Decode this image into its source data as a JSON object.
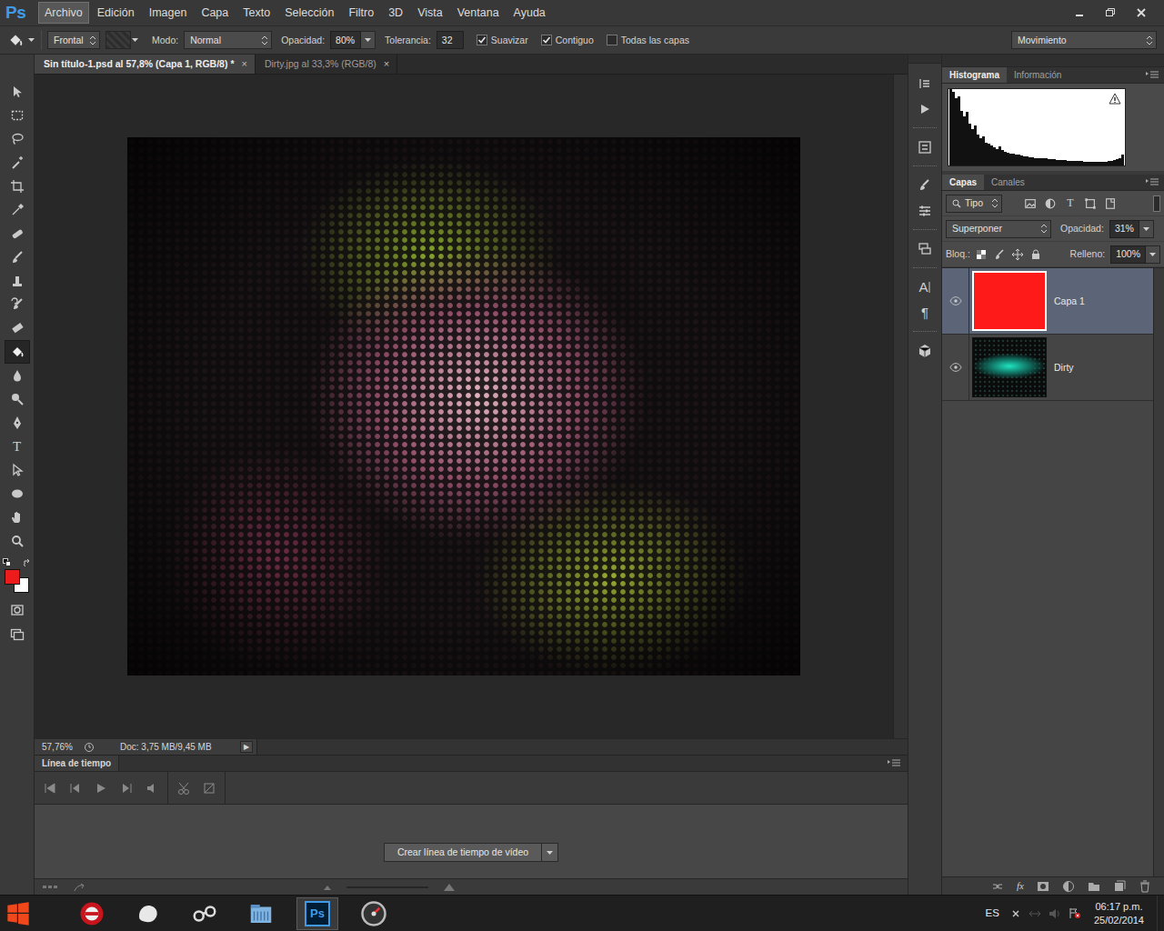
{
  "app": {
    "logo": "Ps"
  },
  "menu": [
    {
      "label": "Archivo",
      "selected": true
    },
    {
      "label": "Edición",
      "selected": false
    },
    {
      "label": "Imagen",
      "selected": false
    },
    {
      "label": "Capa",
      "selected": false
    },
    {
      "label": "Texto",
      "selected": false
    },
    {
      "label": "Selección",
      "selected": false
    },
    {
      "label": "Filtro",
      "selected": false
    },
    {
      "label": "3D",
      "selected": false
    },
    {
      "label": "Vista",
      "selected": false
    },
    {
      "label": "Ventana",
      "selected": false
    },
    {
      "label": "Ayuda",
      "selected": false
    }
  ],
  "options_bar": {
    "fill_source": "Frontal",
    "mode_label": "Modo:",
    "mode": "Normal",
    "opacity_label": "Opacidad:",
    "opacity": "80%",
    "tolerance_label": "Tolerancia:",
    "tolerance": "32",
    "checks": [
      {
        "label": "Suavizar",
        "checked": true
      },
      {
        "label": "Contiguo",
        "checked": true
      },
      {
        "label": "Todas las capas",
        "checked": false
      }
    ],
    "workspace": "Movimiento"
  },
  "doc_tabs": [
    {
      "label": "Sin título-1.psd al 57,8% (Capa 1, RGB/8) *",
      "close": "×",
      "selected": true
    },
    {
      "label": "Dirty.jpg al 33,3% (RGB/8)",
      "close": "×",
      "selected": false
    }
  ],
  "tools": [
    {
      "kind": "move",
      "selected": false
    },
    {
      "kind": "marquee",
      "selected": false
    },
    {
      "kind": "lasso",
      "selected": false
    },
    {
      "kind": "wand",
      "selected": false
    },
    {
      "kind": "crop",
      "selected": false
    },
    {
      "kind": "eyedropper",
      "selected": false
    },
    {
      "kind": "heal",
      "selected": false
    },
    {
      "kind": "brush",
      "selected": false
    },
    {
      "kind": "stamp",
      "selected": false
    },
    {
      "kind": "history",
      "selected": false
    },
    {
      "kind": "eraser",
      "selected": false
    },
    {
      "kind": "bucket",
      "selected": true
    },
    {
      "kind": "blur",
      "selected": false
    },
    {
      "kind": "dodge",
      "selected": false
    },
    {
      "kind": "pen",
      "selected": false
    },
    {
      "kind": "type",
      "label": "T",
      "selected": false
    },
    {
      "kind": "pathselect",
      "selected": false
    },
    {
      "kind": "ellipse",
      "selected": false
    },
    {
      "kind": "hand",
      "selected": false
    },
    {
      "kind": "zoom",
      "selected": false
    },
    {
      "kind": "quickmask",
      "selected": false
    },
    {
      "kind": "screenmode",
      "selected": false
    }
  ],
  "colors": [
    {
      "color": "#ed1c1c"
    },
    {
      "color": "#ffffff"
    }
  ],
  "status_bar": {
    "zoom": "57,76%",
    "doc_size": "Doc: 3,75 MB/9,45 MB",
    "menu_arrow": "▶"
  },
  "timeline": {
    "title": "Línea de tiempo",
    "create_button": "Crear línea de tiempo de vídeo"
  },
  "panel_strip": [
    {
      "kind": "history"
    },
    {
      "kind": "actions"
    },
    {
      "kind": "properties"
    },
    {
      "kind": "brushes"
    },
    {
      "kind": "adjust"
    },
    {
      "kind": "comps"
    },
    {
      "kind": "character",
      "label": "A"
    },
    {
      "kind": "paragraph",
      "label": "¶"
    },
    {
      "kind": "cube"
    }
  ],
  "histogram_panel": {
    "tabs": [
      {
        "label": "Histograma",
        "selected": true
      },
      {
        "label": "Información",
        "selected": false
      }
    ],
    "values": [
      100,
      96,
      88,
      90,
      72,
      64,
      70,
      55,
      48,
      52,
      40,
      36,
      38,
      30,
      28,
      26,
      24,
      22,
      25,
      20,
      18,
      17,
      16,
      15,
      14,
      14,
      13,
      12,
      12,
      11,
      11,
      10,
      10,
      9,
      9,
      9,
      8,
      8,
      8,
      7,
      7,
      7,
      7,
      6,
      6,
      6,
      6,
      6,
      6,
      5,
      5,
      5,
      5,
      5,
      5,
      5,
      5,
      5,
      6,
      6,
      7,
      8,
      10,
      14
    ]
  },
  "layers_panel": {
    "tabs": [
      {
        "label": "Capas",
        "selected": true
      },
      {
        "label": "Canales",
        "selected": false
      }
    ],
    "filter": "Tipo",
    "filter_icons": [
      {
        "kind": "pixel"
      },
      {
        "kind": "adjustment"
      },
      {
        "kind": "type",
        "label": "T"
      },
      {
        "kind": "shape"
      },
      {
        "kind": "smart"
      }
    ],
    "blend_mode": "Superponer",
    "opacity_label": "Opacidad:",
    "opacity": "31%",
    "lock_label": "Bloq.:",
    "fill_label": "Relleno:",
    "fill": "100%",
    "layers": [
      {
        "name": "Capa 1",
        "kind": "fill",
        "color": "#ff1a1a",
        "visible": true,
        "selected": true
      },
      {
        "name": "Dirty",
        "kind": "photo",
        "visible": true,
        "selected": false
      }
    ],
    "footer_fx": "fx"
  },
  "taskbar": {
    "apps": [
      {
        "kind": "browser",
        "selected": false
      },
      {
        "kind": "stone",
        "selected": false
      },
      {
        "kind": "link",
        "selected": false
      },
      {
        "kind": "library",
        "selected": false
      },
      {
        "kind": "photoshop",
        "label": "Ps",
        "selected": true
      },
      {
        "kind": "gauge",
        "selected": false
      }
    ],
    "language": "ES",
    "time": "06:17 p.m.",
    "date": "25/02/2014"
  }
}
